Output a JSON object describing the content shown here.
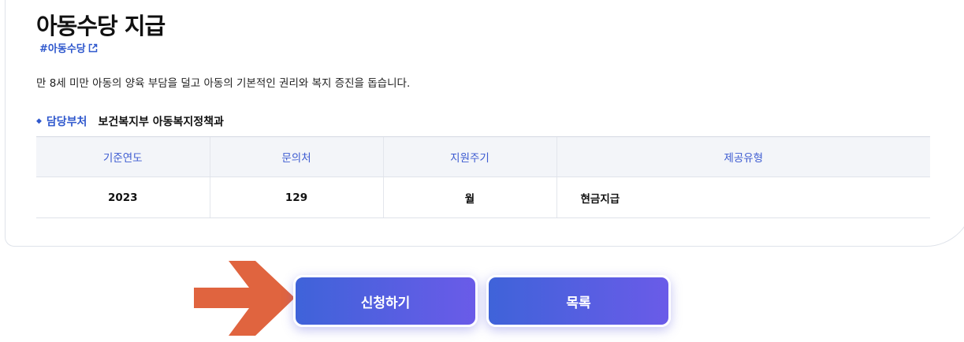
{
  "service": {
    "title": "아동수당 지급",
    "hashtag": "#아동수당",
    "description": "만 8세 미만 아동의 양육 부담을 덜고 아동의 기본적인 권리와 복지 증진을 돕습니다.",
    "department_label": "담당부처",
    "department_value": "보건복지부 아동복지정책과"
  },
  "info_table": {
    "headers": [
      "기준연도",
      "문의처",
      "지원주기",
      "제공유형"
    ],
    "row": [
      "2023",
      "129",
      "월",
      "현금지급"
    ]
  },
  "buttons": {
    "apply": "신청하기",
    "list": "목록"
  },
  "colors": {
    "accent": "#2f58cd",
    "arrow": "#e0643f",
    "button_gradient_start": "#3f63d9",
    "button_gradient_end": "#6a5be8"
  }
}
